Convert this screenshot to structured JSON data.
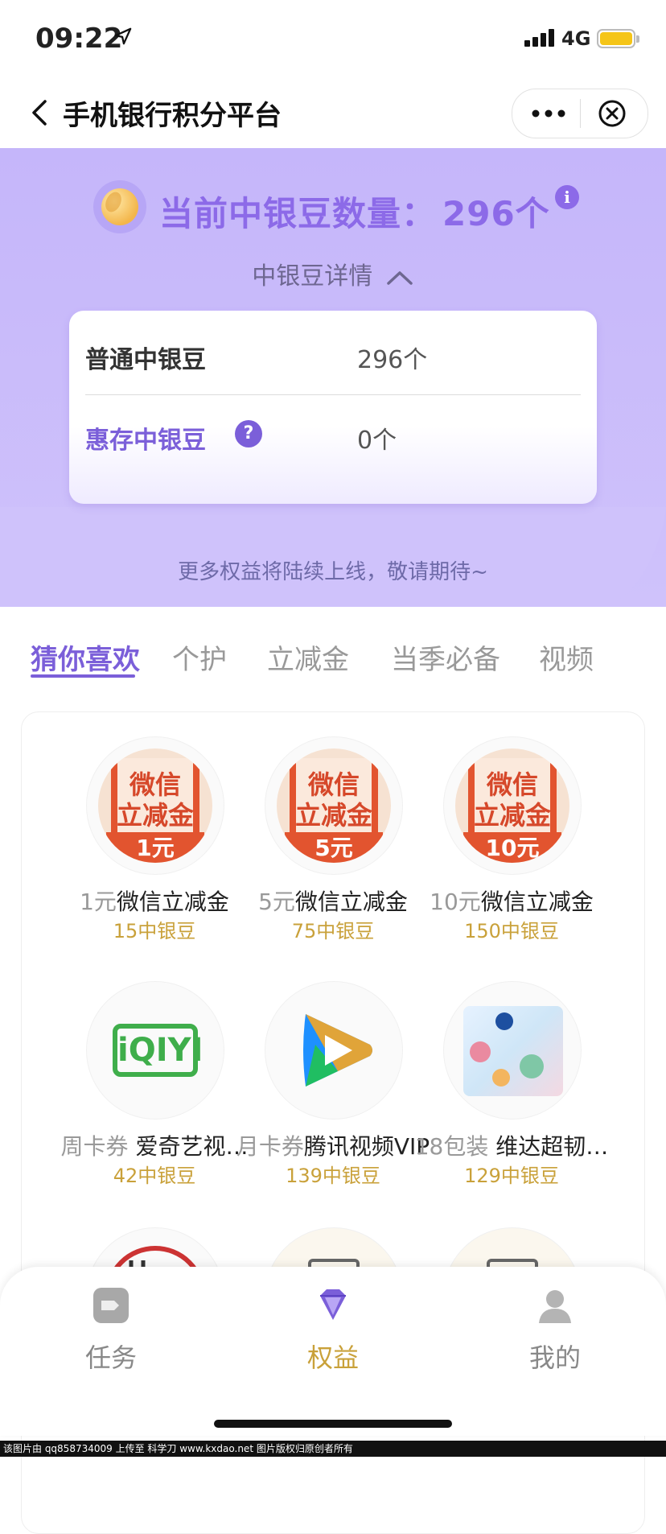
{
  "status_bar": {
    "time": "09:22",
    "network": "4G"
  },
  "nav": {
    "title": "手机银行积分平台"
  },
  "header": {
    "count_label": "当前中银豆数量：",
    "count_value": "296个",
    "detail_toggle": "中银豆详情",
    "rows": [
      {
        "label": "普通中银豆",
        "value": "296个"
      },
      {
        "label": "惠存中银豆",
        "value": "0个"
      }
    ],
    "notice": "更多权益将陆续上线，敬请期待~"
  },
  "tabs": [
    "猜你喜欢",
    "个护",
    "立减金",
    "当季必备",
    "视频"
  ],
  "active_tab": "猜你喜欢",
  "products": [
    {
      "prefix": "1元",
      "name": "微信立减金",
      "price": "15中银豆",
      "thumb_text": [
        "微信",
        "立减金"
      ],
      "badge": "1元"
    },
    {
      "prefix": "5元",
      "name": "微信立减金",
      "price": "75中银豆",
      "thumb_text": [
        "微信",
        "立减金"
      ],
      "badge": "5元"
    },
    {
      "prefix": "10元",
      "name": "微信立减金",
      "price": "150中银豆",
      "thumb_text": [
        "微信",
        "立减金"
      ],
      "badge": "10元"
    },
    {
      "prefix": "周卡券",
      "name": " 爱奇艺视…",
      "price": "42中银豆",
      "thumb_text": "iQIYI"
    },
    {
      "prefix": "月卡券",
      "name": "腾讯视频VIP",
      "price": "139中银豆"
    },
    {
      "prefix": "18包装",
      "name": " 维达超韧…",
      "price": "129中银豆"
    }
  ],
  "tabbar": [
    {
      "label": "任务",
      "icon": "task-icon"
    },
    {
      "label": "权益",
      "icon": "diamond-icon"
    },
    {
      "label": "我的",
      "icon": "user-icon"
    }
  ],
  "active_tabbar": "权益",
  "watermark": "该图片由 qq858734009 上传至 科学刀 www.kxdao.net 图片版权归原创者所有",
  "colors": {
    "accent": "#7b5fd9",
    "header_bg": "#c5b6fa",
    "price": "#c9a13a",
    "wx_red": "#e2542f",
    "iqiyi_green": "#3fae4b"
  }
}
